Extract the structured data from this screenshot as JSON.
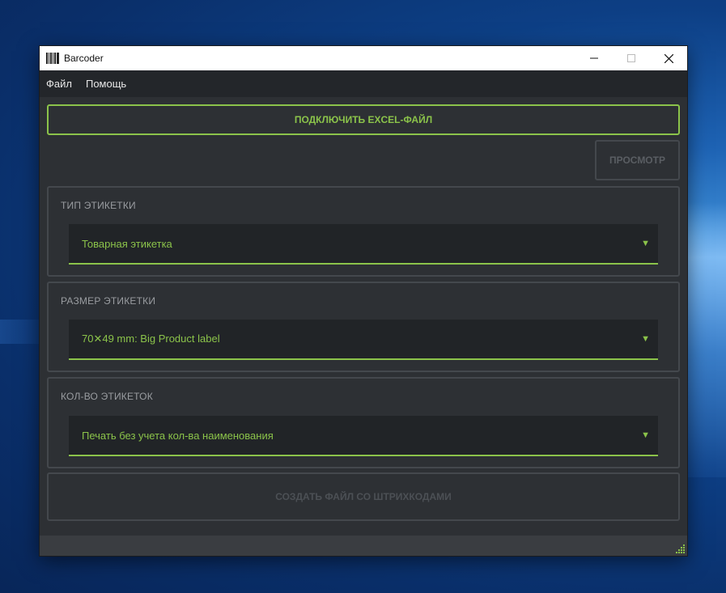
{
  "window": {
    "title": "Barcoder",
    "icon": "barcode-icon"
  },
  "menu": {
    "items": [
      "Файл",
      "Помощь"
    ]
  },
  "actions": {
    "connect_label": "ПОДКЛЮЧИТЬ EXCEL-ФАЙЛ",
    "preview_label": "ПРОСМОТР",
    "create_label": "СОЗДАТЬ ФАЙЛ СО ШТРИХКОДАМИ"
  },
  "groups": {
    "label_type": {
      "title": "ТИП ЭТИКЕТКИ",
      "value": "Товарная этикетка"
    },
    "label_size": {
      "title": "РАЗМЕР ЭТИКЕТКИ",
      "value": "70✕49 mm: Big Product label"
    },
    "label_count": {
      "title": "КОЛ-ВО ЭТИКЕТОК",
      "value": "Печать без учета кол-ва наименования"
    }
  },
  "colors": {
    "accent": "#8bc34a",
    "background": "#2d3034",
    "field": "#212427",
    "disabled": "#4c5055"
  }
}
